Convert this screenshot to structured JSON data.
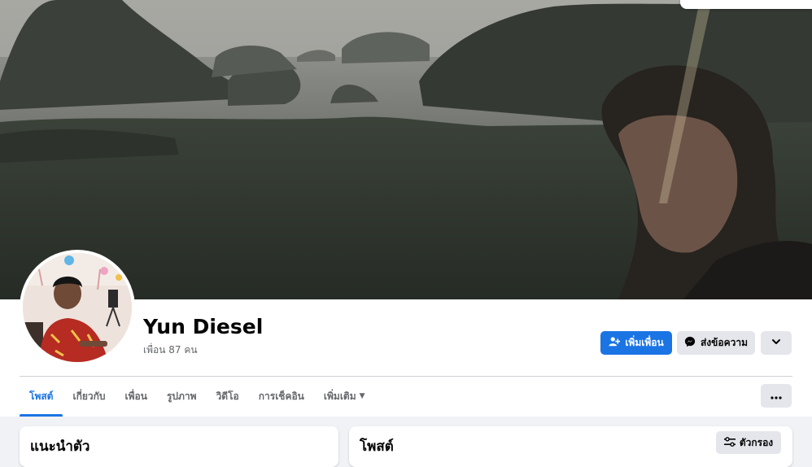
{
  "profile": {
    "name": "Yun Diesel",
    "friends_count": "เพื่อน 87 คน"
  },
  "actions": {
    "add_friend_label": "เพิ่มเพื่อน",
    "message_label": "ส่งข้อความ"
  },
  "tabs": [
    {
      "label": "โพสต์",
      "active": true
    },
    {
      "label": "เกี่ยวกับ",
      "active": false
    },
    {
      "label": "เพื่อน",
      "active": false
    },
    {
      "label": "รูปภาพ",
      "active": false
    },
    {
      "label": "วิดีโอ",
      "active": false
    },
    {
      "label": "การเช็คอิน",
      "active": false
    },
    {
      "label": "เพิ่มเติม",
      "active": false
    }
  ],
  "intro_card": {
    "title": "แนะนำตัว"
  },
  "posts_card": {
    "title": "โพสต์",
    "filter_label": "ตัวกรอง"
  },
  "colors": {
    "accent": "#1b74e4",
    "secondary_button": "#e4e6eb",
    "page_background": "#f0f2f5"
  },
  "icons": {
    "add_friend": "add-person-icon",
    "message": "messenger-icon",
    "expand": "chevron-down-icon",
    "more_tabs": "caret-down-icon",
    "overflow": "more-dots-icon",
    "filter": "filter-sliders-icon"
  }
}
